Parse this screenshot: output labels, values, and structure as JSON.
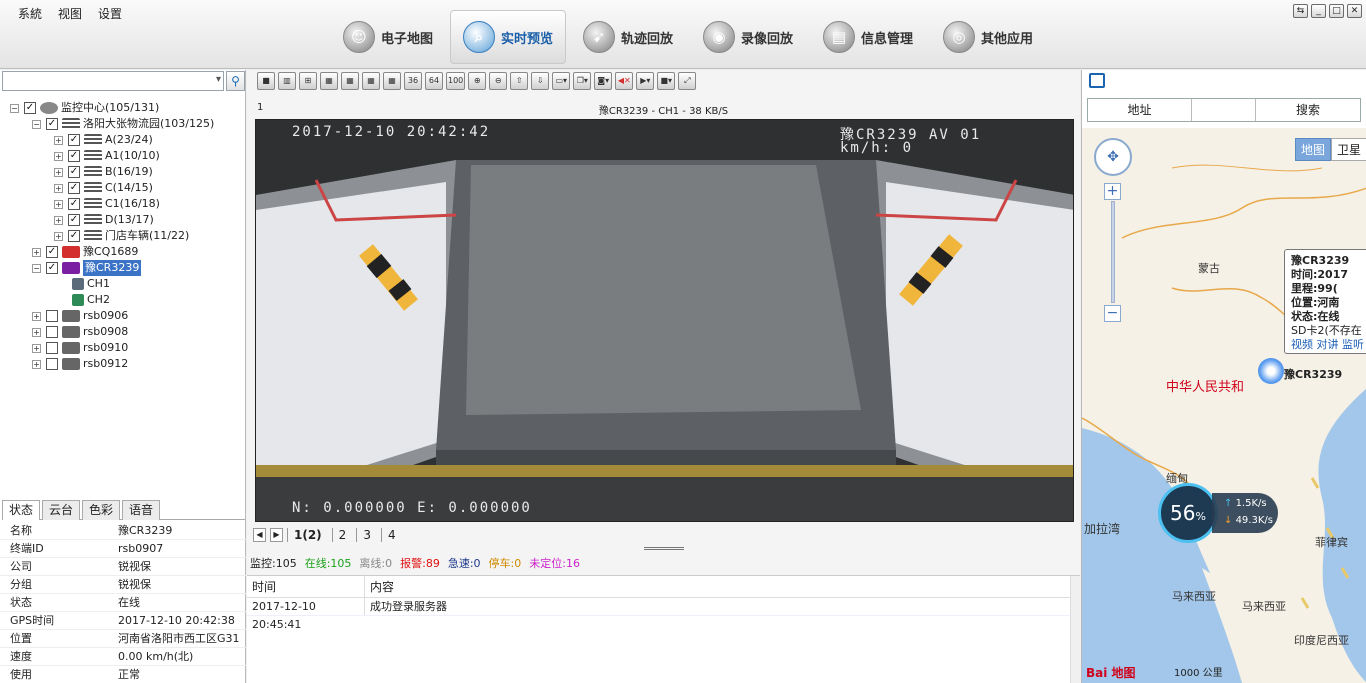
{
  "menu": [
    "系統",
    "视图",
    "设置"
  ],
  "main_tabs": [
    {
      "label": "电子地图",
      "icon": "person-map-icon"
    },
    {
      "label": "实时预览",
      "icon": "search-icon"
    },
    {
      "label": "轨迹回放",
      "icon": "track-icon"
    },
    {
      "label": "录像回放",
      "icon": "video-reel-icon"
    },
    {
      "label": "信息管理",
      "icon": "info-icon"
    },
    {
      "label": "其他应用",
      "icon": "app-icon"
    }
  ],
  "tree": [
    {
      "label": "监控中心(105/131)"
    },
    {
      "label": "洛阳大张物流园(103/125)"
    },
    {
      "label": "A(23/24)"
    },
    {
      "label": "A1(10/10)"
    },
    {
      "label": "B(16/19)"
    },
    {
      "label": "C(14/15)"
    },
    {
      "label": "C1(16/18)"
    },
    {
      "label": "D(13/17)"
    },
    {
      "label": "门店车辆(11/22)"
    },
    {
      "label": "豫CQ1689"
    },
    {
      "label": "豫CR3239"
    },
    {
      "label": "CH1"
    },
    {
      "label": "CH2"
    },
    {
      "label": "rsb0906"
    },
    {
      "label": "rsb0908"
    },
    {
      "label": "rsb0910"
    },
    {
      "label": "rsb0912"
    }
  ],
  "left_tabs": [
    "状态",
    "云台",
    "色彩",
    "语音"
  ],
  "props": [
    {
      "k": "名称",
      "v": "豫CR3239"
    },
    {
      "k": "终端ID",
      "v": "rsb0907"
    },
    {
      "k": "公司",
      "v": "锐视保"
    },
    {
      "k": "分组",
      "v": "锐视保"
    },
    {
      "k": "状态",
      "v": "在线"
    },
    {
      "k": "GPS时间",
      "v": "2017-12-10 20:42:38"
    },
    {
      "k": "位置",
      "v": "河南省洛阳市西工区G31"
    },
    {
      "k": "速度",
      "v": "0.00 km/h(北)"
    },
    {
      "k": "使用",
      "v": "正常"
    }
  ],
  "toolbar_labels": [
    "36",
    "64",
    "100"
  ],
  "video": {
    "window_number": "1",
    "caption": "豫CR3239 - CH1 - 38 KB/S",
    "osd_datetime": "2017-12-10  20:42:42",
    "osd_plate": "豫CR3239  AV  01",
    "osd_speed": "km/h:          0",
    "osd_gps": "N:  0.000000  E:  0.000000"
  },
  "view_tabs": [
    "1(2)",
    "2",
    "3",
    "4"
  ],
  "stats": [
    {
      "label": "监控:105",
      "color": "#222222"
    },
    {
      "label": "在线:105",
      "color": "#19a019"
    },
    {
      "label": "离线:0",
      "color": "#888888"
    },
    {
      "label": "报警:89",
      "color": "#e01010"
    },
    {
      "label": "急速:0",
      "color": "#1d3a8a"
    },
    {
      "label": "停车:0",
      "color": "#d08a00"
    },
    {
      "label": "未定位:16",
      "color": "#cc22cc"
    }
  ],
  "log": {
    "col_time": "时间",
    "col_content": "内容",
    "rows": [
      {
        "time": "2017-12-10 20:45:41",
        "content": "成功登录服务器"
      }
    ]
  },
  "map": {
    "address_label": "地址",
    "search_label": "搜索",
    "map_type": "地图",
    "satellite_type": "卫星",
    "labels": [
      "蒙古",
      "中华人民共和",
      "缅甸",
      "加拉湾",
      "马来西亚",
      "马来西亚",
      "菲律宾",
      "印度尼西亚"
    ],
    "popup": {
      "plate": "豫CR3239",
      "time": "时间:2017",
      "mileage": "里程:99(",
      "position": "位置:河南",
      "status": "状态:在线",
      "sd": "SD卡2(不存在",
      "links": [
        "视频",
        "对讲",
        "监听"
      ]
    },
    "vehicle_label": "豫CR3239",
    "net": {
      "percent": "56",
      "up": "1.5K/s",
      "down": "49.3K/s"
    },
    "scale": "1000 公里",
    "logo": "Bai 地图"
  }
}
